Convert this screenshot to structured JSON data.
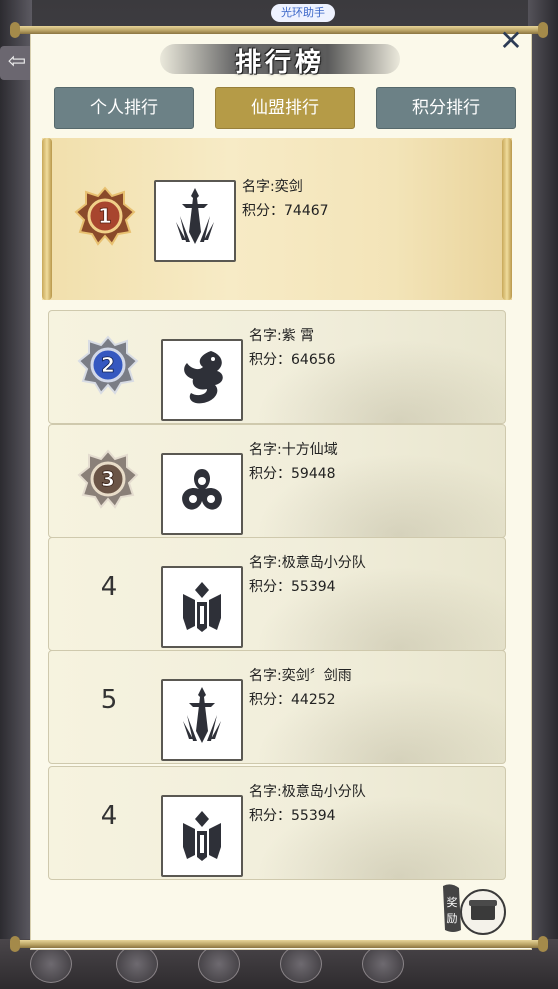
{
  "top_badge": "光环助手",
  "title": "排行榜",
  "tabs": [
    {
      "label": "个人排行",
      "active": false
    },
    {
      "label": "仙盟排行",
      "active": true
    },
    {
      "label": "积分排行",
      "active": false
    }
  ],
  "rows": [
    {
      "rank": "1",
      "name": "名字:奕剑",
      "score": "积分：74467",
      "emblem": "sword-icon"
    },
    {
      "rank": "2",
      "name": "名字:紫 霄",
      "score": "积分：64656",
      "emblem": "dragon-icon"
    },
    {
      "rank": "3",
      "name": "名字:十方仙域",
      "score": "积分：59448",
      "emblem": "trefoil-icon"
    },
    {
      "rank": "4",
      "name": "名字:极意岛小分队",
      "score": "积分：55394",
      "emblem": "crest-icon"
    },
    {
      "rank": "5",
      "name": "名字:奕剑〞剑雨",
      "score": "积分：44252",
      "emblem": "sword-icon"
    },
    {
      "rank": "4",
      "name": "名字:极意岛小分队",
      "score": "积分：55394",
      "emblem": "crest-icon"
    }
  ],
  "reward": {
    "label": "奖励"
  },
  "colors": {
    "active_tab": "#b59b47",
    "inactive_tab": "#6c8186",
    "panel_bg": "#fbf9ea"
  }
}
